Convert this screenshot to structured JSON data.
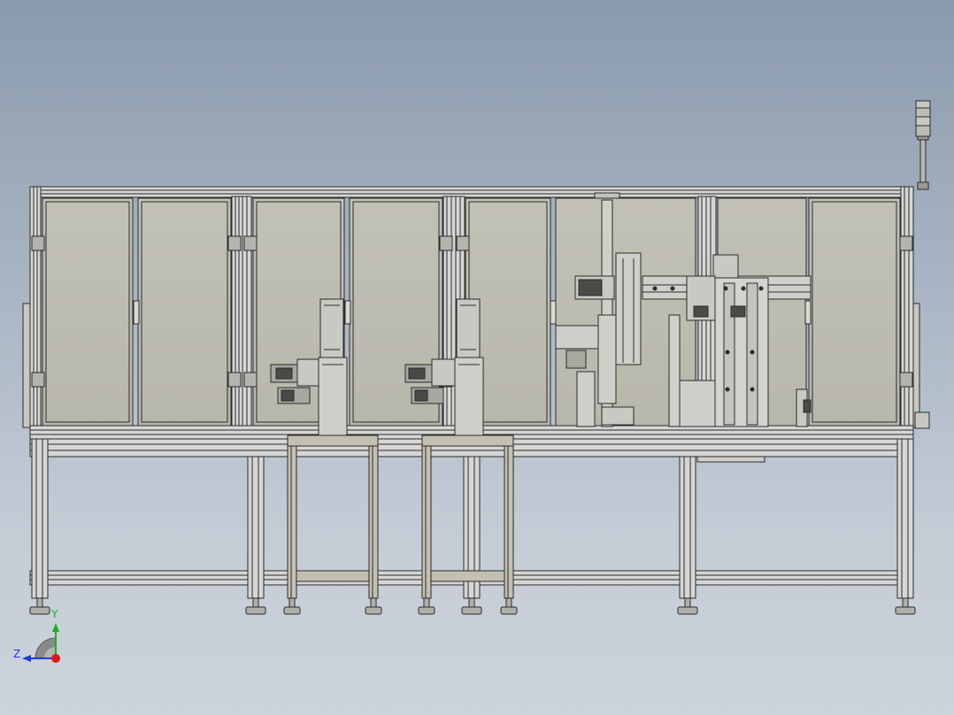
{
  "app": {
    "kind": "cad-model-viewport",
    "view": "front-orthographic"
  },
  "colors": {
    "background_top": "#8a9aad",
    "background_bottom": "#cdd3db",
    "panel_fill": "#bdbcb0",
    "frame_fill": "#d6d6d4",
    "line": "#2b2b2b",
    "stand_fill": "#c3c0b2",
    "axis_x": "#e01818",
    "axis_y": "#17b317",
    "axis_z": "#1e3dd6"
  },
  "model": {
    "components": [
      "aluminum-profile-frame-icon",
      "enclosure-panel-icon",
      "door-handle-icon",
      "hinge-icon",
      "stack-light-icon",
      "servo-motor-icon",
      "gantry-module-icon",
      "leveling-foot-icon",
      "side-stand-icon"
    ]
  },
  "triad": {
    "y_label": "Y",
    "z_label": "Z",
    "icon": "coordinate-triad-icon"
  }
}
